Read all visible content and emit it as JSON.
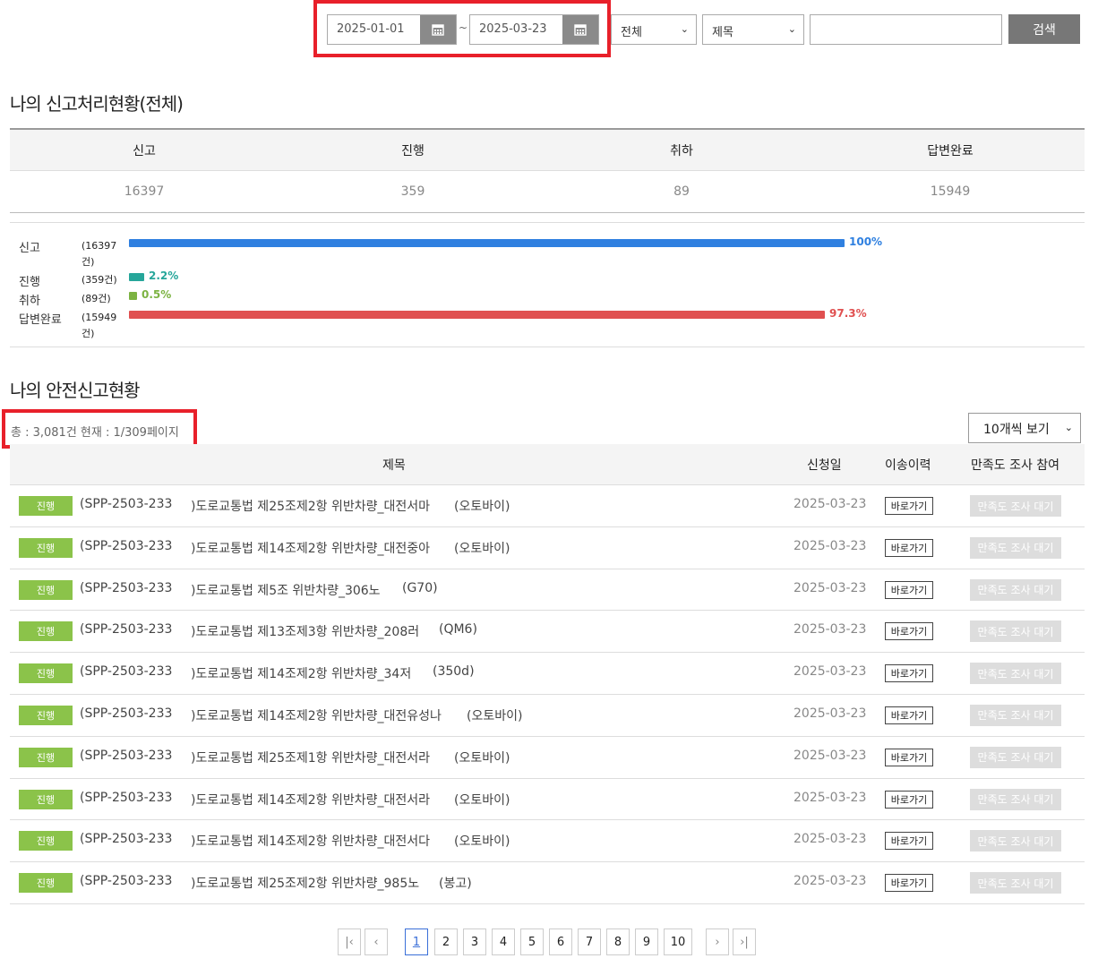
{
  "search": {
    "date_from": "2025-01-01",
    "date_to": "2025-03-23",
    "tilde": "~",
    "status_select": "전체",
    "field_select": "제목",
    "keyword": "",
    "search_button": "검색"
  },
  "summary": {
    "title": "나의 신고처리현황(전체)",
    "headers": [
      "신고",
      "진행",
      "취하",
      "답변완료"
    ],
    "values": [
      "16397",
      "359",
      "89",
      "15949"
    ]
  },
  "chart_data": {
    "type": "bar",
    "categories": [
      "신고",
      "진행",
      "취하",
      "답변완료"
    ],
    "counts": [
      "(16397건)",
      "(359건)",
      "(89건)",
      "(15949건)"
    ],
    "values": [
      100,
      2.2,
      0.5,
      97.3
    ],
    "labels": [
      "100%",
      "2.2%",
      "0.5%",
      "97.3%"
    ],
    "colors": [
      "#2f80e0",
      "#26a69a",
      "#7cb342",
      "#e05050"
    ]
  },
  "list": {
    "title": "나의 안전신고현황",
    "total_text": "총 : 3,081건    현재 : 1/309페이지",
    "per_page": "10개씩 보기",
    "columns": [
      "제목",
      "신청일",
      "이송이력",
      "만족도 조사 참여"
    ],
    "rows": [
      {
        "status": "진행",
        "code": "(SPP-2503-233",
        "title": ")도로교통법 제25조제2항 위반차량_대전서마",
        "vehicle": "(오토바이)",
        "date": "2025-03-23",
        "goto": "바로가기",
        "survey": "만족도 조사 대기"
      },
      {
        "status": "진행",
        "code": "(SPP-2503-233",
        "title": ")도로교통법 제14조제2항 위반차량_대전중아",
        "vehicle": "(오토바이)",
        "date": "2025-03-23",
        "goto": "바로가기",
        "survey": "만족도 조사 대기"
      },
      {
        "status": "진행",
        "code": "(SPP-2503-233",
        "title": ")도로교통법 제5조 위반차량_306노",
        "vehicle": "(G70)",
        "date": "2025-03-23",
        "goto": "바로가기",
        "survey": "만족도 조사 대기"
      },
      {
        "status": "진행",
        "code": "(SPP-2503-233",
        "title": ")도로교통법 제13조제3항 위반차량_208러",
        "vehicle": "(QM6)",
        "date": "2025-03-23",
        "goto": "바로가기",
        "survey": "만족도 조사 대기"
      },
      {
        "status": "진행",
        "code": "(SPP-2503-233",
        "title": ")도로교통법 제14조제2항 위반차량_34저",
        "vehicle": "(350d)",
        "date": "2025-03-23",
        "goto": "바로가기",
        "survey": "만족도 조사 대기"
      },
      {
        "status": "진행",
        "code": "(SPP-2503-233",
        "title": ")도로교통법 제14조제2항 위반차량_대전유성나",
        "vehicle": "(오토바이)",
        "date": "2025-03-23",
        "goto": "바로가기",
        "survey": "만족도 조사 대기"
      },
      {
        "status": "진행",
        "code": "(SPP-2503-233",
        "title": ")도로교통법 제25조제1항 위반차량_대전서라",
        "vehicle": "(오토바이)",
        "date": "2025-03-23",
        "goto": "바로가기",
        "survey": "만족도 조사 대기"
      },
      {
        "status": "진행",
        "code": "(SPP-2503-233",
        "title": ")도로교통법 제14조제2항 위반차량_대전서라",
        "vehicle": "(오토바이)",
        "date": "2025-03-23",
        "goto": "바로가기",
        "survey": "만족도 조사 대기"
      },
      {
        "status": "진행",
        "code": "(SPP-2503-233",
        "title": ")도로교통법 제14조제2항 위반차량_대전서다",
        "vehicle": "(오토바이)",
        "date": "2025-03-23",
        "goto": "바로가기",
        "survey": "만족도 조사 대기"
      },
      {
        "status": "진행",
        "code": "(SPP-2503-233",
        "title": ")도로교통법 제25조제2항 위반차량_985노",
        "vehicle": "(봉고)",
        "date": "2025-03-23",
        "goto": "바로가기",
        "survey": "만족도 조사 대기"
      }
    ]
  },
  "pagination": {
    "pages": [
      "1",
      "2",
      "3",
      "4",
      "5",
      "6",
      "7",
      "8",
      "9",
      "10"
    ],
    "current": "1",
    "first": "first-page-icon",
    "prev": "prev-page-icon",
    "next": "next-page-icon",
    "last": "last-page-icon"
  }
}
